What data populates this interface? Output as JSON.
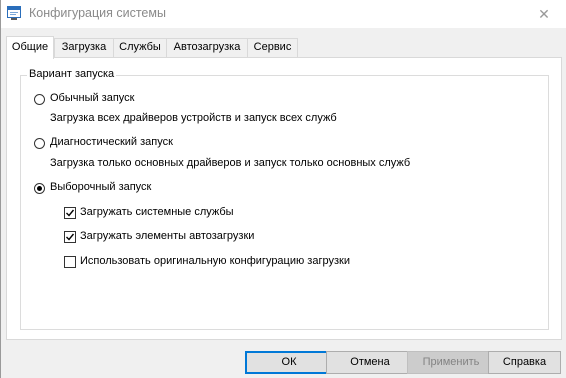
{
  "window": {
    "title": "Конфигурация системы",
    "app_icon": "msconfig-icon",
    "close_icon": "close-icon",
    "close_glyph": "✕"
  },
  "tabs": [
    {
      "label": "Общие",
      "active": true
    },
    {
      "label": "Загрузка",
      "active": false
    },
    {
      "label": "Службы",
      "active": false
    },
    {
      "label": "Автозагрузка",
      "active": false
    },
    {
      "label": "Сервис",
      "active": false
    }
  ],
  "startup": {
    "group_label": "Вариант запуска",
    "normal": {
      "label": "Обычный запуск",
      "description": "Загрузка всех драйверов устройств и запуск всех служб",
      "selected": false
    },
    "diagnostic": {
      "label": "Диагностический запуск",
      "description": "Загрузка только основных драйверов и запуск только основных служб",
      "selected": false
    },
    "selective": {
      "label": "Выборочный запуск",
      "selected": true,
      "options": [
        {
          "label": "Загружать системные службы",
          "checked": true
        },
        {
          "label": "Загружать элементы автозагрузки",
          "checked": true
        },
        {
          "label": "Использовать оригинальную конфигурацию загрузки",
          "checked": false
        }
      ]
    }
  },
  "buttons": {
    "ok": "ОК",
    "cancel": "Отмена",
    "apply": "Применить",
    "help": "Справка"
  }
}
